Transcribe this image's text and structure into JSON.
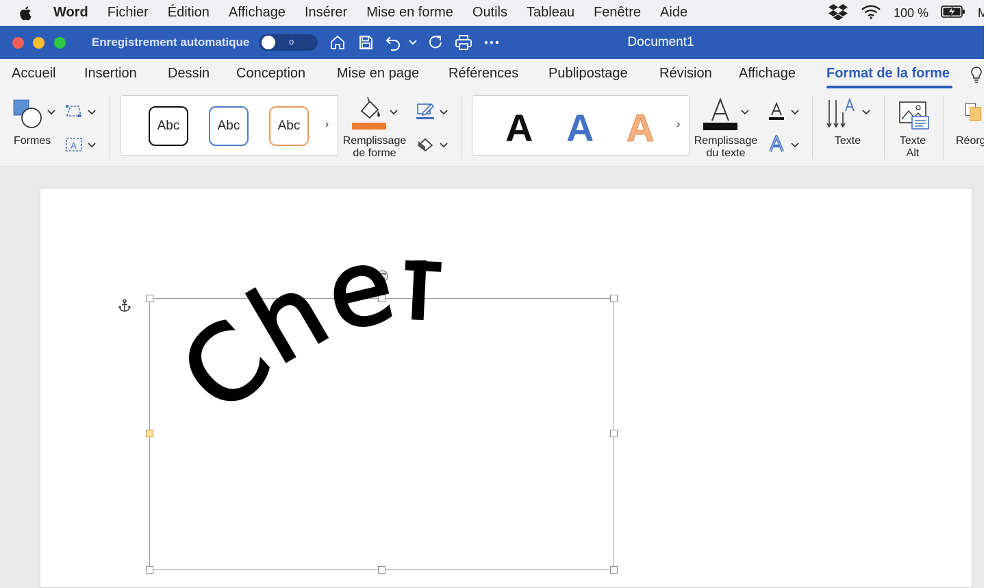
{
  "menubar": {
    "app": "Word",
    "items": [
      "Fichier",
      "Édition",
      "Affichage",
      "Insérer",
      "Mise en forme",
      "Outils",
      "Tableau",
      "Fenêtre",
      "Aide"
    ],
    "battery": "100 %",
    "cut_off": "M"
  },
  "titlebar": {
    "autosave_label": "Enregistrement automatique",
    "autosave_state": "o",
    "document_title": "Document1"
  },
  "tabs": {
    "accueil": "Accueil",
    "insertion": "Insertion",
    "dessin": "Dessin",
    "conception": "Conception",
    "mise_en_page": "Mise en page",
    "references": "Références",
    "publipostage": "Publipostage",
    "revision": "Révision",
    "affichage": "Affichage",
    "format_forme": "Format de la forme"
  },
  "ribbon": {
    "formes_label": "Formes",
    "shape_style_sample": "Abc",
    "remplissage_forme_line1": "Remplissage",
    "remplissage_forme_line2": "de forme",
    "wordart_sample": "A",
    "remplissage_texte_line1": "Remplissage",
    "remplissage_texte_line2": "du texte",
    "texte_label": "Texte",
    "texte_alt_line1": "Texte",
    "texte_alt_line2": "Alt",
    "reorg_label": "Réorg"
  },
  "document": {
    "wordart_text": "Chef"
  },
  "colors": {
    "title_blue": "#2b5db8",
    "fill_orange": "#ee7d31",
    "wordart_blue": "#4472c4",
    "wordart_orange": "#f4b183"
  }
}
